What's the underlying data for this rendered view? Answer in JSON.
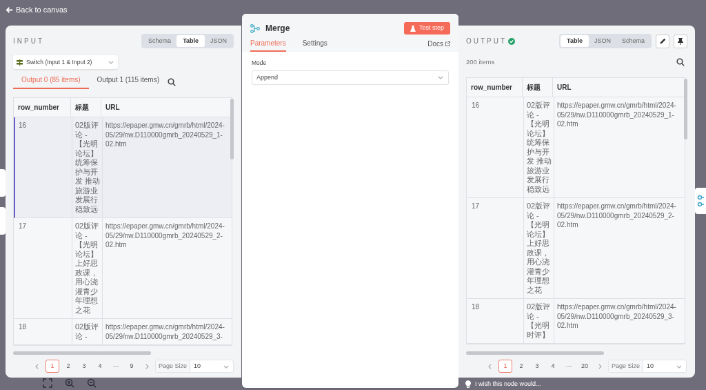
{
  "back_link": "Back to canvas",
  "input": {
    "title": "INPUT",
    "view_tabs": [
      {
        "label": "Schema",
        "selected": false
      },
      {
        "label": "Table",
        "selected": true
      },
      {
        "label": "JSON",
        "selected": false
      }
    ],
    "source_select": {
      "value": "Switch (Input 1 & Input 2)"
    },
    "output_tabs": [
      {
        "label": "Output 0 (85 items)",
        "selected": true
      },
      {
        "label": "Output 1 (115 items)",
        "selected": false
      }
    ],
    "table": {
      "columns": [
        "row_number",
        "标题",
        "URL"
      ],
      "rows": [
        {
          "selected": true,
          "cells": [
            "16",
            "02版评论 -【光明论坛】统筹保护与开发 推动旅游业发展行稳致远",
            "https://epaper.gmw.cn/gmrb/html/2024-05/29/nw.D110000gmrb_20240529_1-02.htm"
          ]
        },
        {
          "selected": false,
          "cells": [
            "17",
            "02版评论 -【光明论坛】上好思政课，用心浇灌青少年理想之花",
            "https://epaper.gmw.cn/gmrb/html/2024-05/29/nw.D110000gmrb_20240529_2-02.htm"
          ]
        },
        {
          "selected": false,
          "cells": [
            "18",
            "02版评论 -",
            "https://epaper.gmw.cn/gmrb/html/2024-05/29/nw.D110000gmrb_20240529_3-"
          ]
        }
      ]
    },
    "pagination": {
      "pages": [
        {
          "label": "1",
          "selected": true
        },
        {
          "label": "2",
          "selected": false
        },
        {
          "label": "3",
          "selected": false
        },
        {
          "label": "4",
          "selected": false
        },
        {
          "label": "···",
          "selected": false
        },
        {
          "label": "9",
          "selected": false
        }
      ],
      "page_size_label": "Page Size",
      "page_size": "10"
    }
  },
  "node": {
    "title": "Merge",
    "test_button": "Test step",
    "tabs": [
      {
        "label": "Parameters",
        "selected": true
      },
      {
        "label": "Settings",
        "selected": false
      }
    ],
    "docs_link": "Docs",
    "mode_label": "Mode",
    "mode_value": "Append"
  },
  "output": {
    "title": "OUTPUT",
    "success": true,
    "view_tabs": [
      {
        "label": "Table",
        "selected": true
      },
      {
        "label": "JSON",
        "selected": false
      },
      {
        "label": "Schema",
        "selected": false
      }
    ],
    "item_count": "200 items",
    "table": {
      "columns": [
        "row_number",
        "标题",
        "URL"
      ],
      "rows": [
        {
          "cells": [
            "16",
            "02版评论 -【光明论坛】统筹保护与开发 推动旅游业发展行稳致远",
            "https://epaper.gmw.cn/gmrb/html/2024-05/29/nw.D110000gmrb_20240529_1-02.htm"
          ]
        },
        {
          "cells": [
            "17",
            "02版评论 -【光明论坛】上好思政课，用心浇灌青少年理想之花",
            "https://epaper.gmw.cn/gmrb/html/2024-05/29/nw.D110000gmrb_20240529_2-02.htm"
          ]
        },
        {
          "cells": [
            "18",
            "02版评论 -【光明时评】",
            "https://epaper.gmw.cn/gmrb/html/2024-05/29/nw.D110000gmrb_20240529_3-02.htm"
          ]
        }
      ]
    },
    "pagination": {
      "pages": [
        {
          "label": "1",
          "selected": true
        },
        {
          "label": "2",
          "selected": false
        },
        {
          "label": "3",
          "selected": false
        },
        {
          "label": "4",
          "selected": false
        },
        {
          "label": "···",
          "selected": false
        },
        {
          "label": "20",
          "selected": false
        }
      ],
      "page_size_label": "Page Size",
      "page_size": "10"
    }
  },
  "hint": "I wish this node would..."
}
